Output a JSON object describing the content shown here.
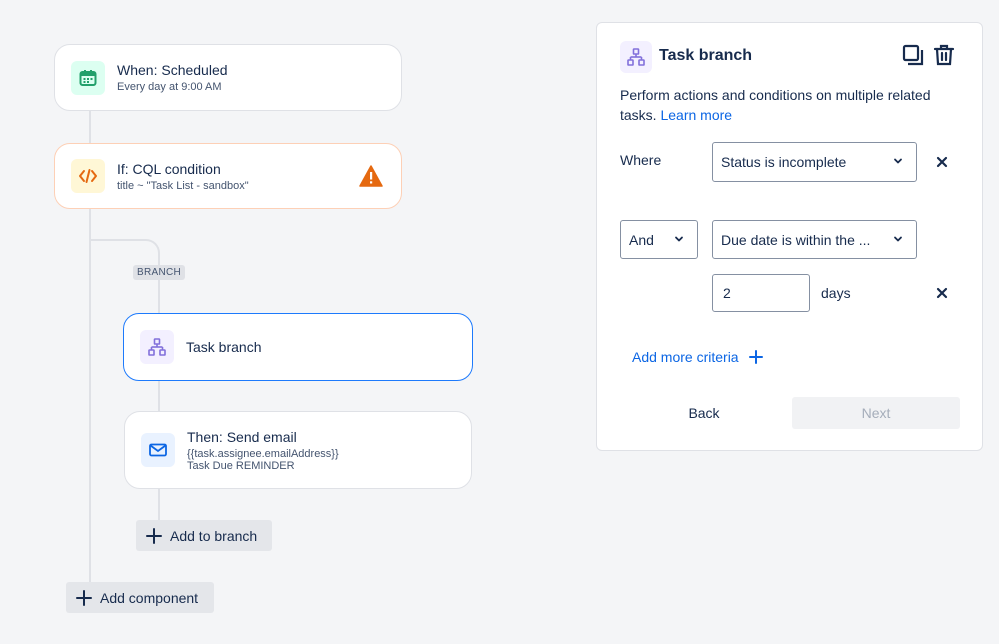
{
  "canvas": {
    "trigger": {
      "title": "When: Scheduled",
      "subtitle": "Every day at 9:00 AM",
      "icon": "calendar-icon"
    },
    "condition": {
      "title": "If: CQL condition",
      "subtitle": "title ~ \"Task List - sandbox\"",
      "icon": "code-icon",
      "warning_icon": "warning-icon"
    },
    "branch_label": "BRANCH",
    "branch": {
      "title": "Task branch",
      "icon": "hierarchy-icon"
    },
    "action": {
      "title": "Then: Send email",
      "line1": "{{task.assignee.emailAddress}}",
      "line2": "Task Due REMINDER",
      "icon": "mail-icon"
    },
    "add_to_branch": "Add to branch",
    "add_component": "Add component"
  },
  "panel": {
    "title": "Task branch",
    "description": "Perform actions and conditions on multiple related tasks.",
    "learn_more": "Learn more",
    "where_label": "Where",
    "where_value": "Status is incomplete",
    "and_value": "And",
    "due_value": "Due date is within the ...",
    "days_value": "2",
    "days_label": "days",
    "add_more": "Add more criteria",
    "back": "Back",
    "next": "Next"
  },
  "colors": {
    "accent": "#0c66e4",
    "selected_border": "#1d7afc",
    "warning": "#e56910",
    "condition_border": "#fdd0b6",
    "trigger_icon_bg": "#dcfff1",
    "trigger_icon": "#22a06b",
    "condition_icon_bg": "#fff7d6",
    "branch_icon_bg": "#f3f0ff",
    "branch_icon": "#8270db",
    "email_icon_bg": "#e9f2ff"
  }
}
